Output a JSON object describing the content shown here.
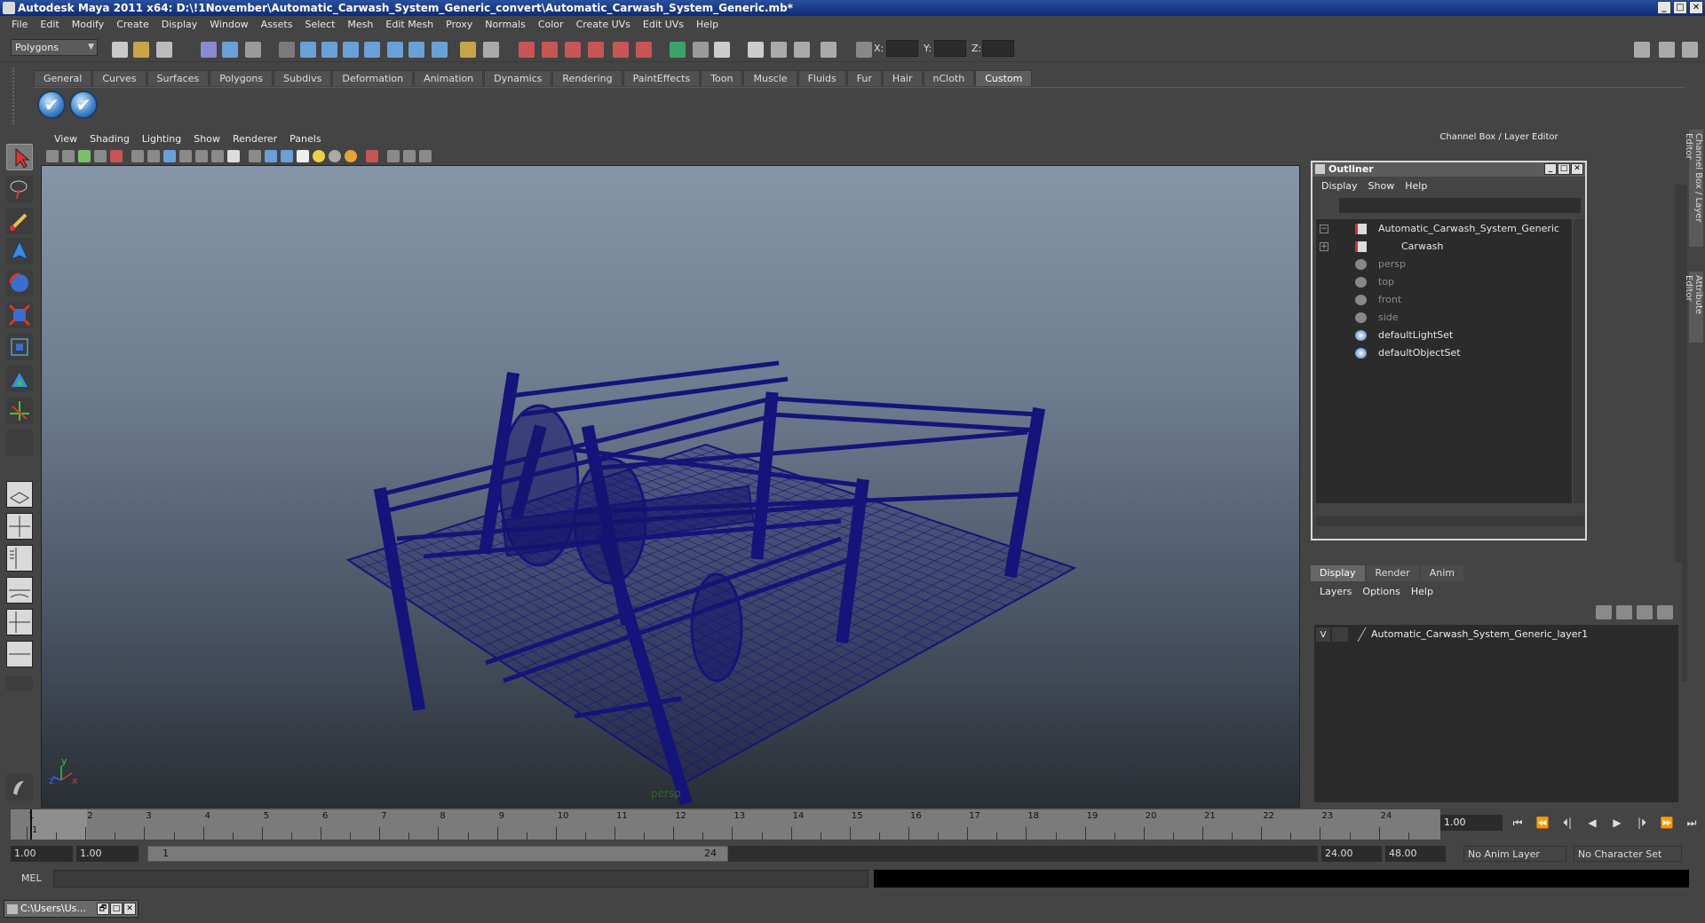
{
  "window": {
    "title": "Autodesk Maya 2011 x64: D:\\!1November\\Automatic_Carwash_System_Generic_convert\\Automatic_Carwash_System_Generic.mb*",
    "buttons": [
      "_",
      "□",
      "✕"
    ]
  },
  "menubar": [
    "File",
    "Edit",
    "Modify",
    "Create",
    "Display",
    "Window",
    "Assets",
    "Select",
    "Mesh",
    "Edit Mesh",
    "Proxy",
    "Normals",
    "Color",
    "Create UVs",
    "Edit UVs",
    "Help"
  ],
  "statusline": {
    "mode": "Polygons",
    "coord_labels": [
      "X:",
      "Y:",
      "Z:"
    ]
  },
  "shelf": {
    "tabs": [
      "General",
      "Curves",
      "Surfaces",
      "Polygons",
      "Subdivs",
      "Deformation",
      "Animation",
      "Dynamics",
      "Rendering",
      "PaintEffects",
      "Toon",
      "Muscle",
      "Fluids",
      "Fur",
      "Hair",
      "nCloth",
      "Custom"
    ],
    "active_tab": "Custom"
  },
  "viewport": {
    "menu": [
      "View",
      "Shading",
      "Lighting",
      "Show",
      "Renderer",
      "Panels"
    ],
    "camera": "persp",
    "axis_labels": [
      "y",
      "x",
      "z"
    ],
    "wire_color": "#14147a"
  },
  "channel_box": {
    "title": "Channel Box / Layer Editor",
    "side_tabs": [
      "Channel Box / Layer Editor",
      "Attribute Editor"
    ]
  },
  "outliner": {
    "title": "Outliner",
    "menu": [
      "Display",
      "Show",
      "Help"
    ],
    "items": [
      {
        "label": "Automatic_Carwash_System_Generic",
        "expander": "−",
        "icon": "transform-icon",
        "dim": false
      },
      {
        "label": "Carwash",
        "expander": "+",
        "icon": "transform-icon",
        "dim": false
      },
      {
        "label": "persp",
        "expander": "",
        "icon": "camera-icon",
        "dim": true
      },
      {
        "label": "top",
        "expander": "",
        "icon": "camera-icon",
        "dim": true
      },
      {
        "label": "front",
        "expander": "",
        "icon": "camera-icon",
        "dim": true
      },
      {
        "label": "side",
        "expander": "",
        "icon": "camera-icon",
        "dim": true
      },
      {
        "label": "defaultLightSet",
        "expander": "",
        "icon": "set-icon",
        "dim": false
      },
      {
        "label": "defaultObjectSet",
        "expander": "",
        "icon": "set-icon",
        "dim": false
      }
    ]
  },
  "layer_editor": {
    "tabs": [
      "Display",
      "Render",
      "Anim"
    ],
    "active_tab": "Display",
    "menu": [
      "Layers",
      "Options",
      "Help"
    ],
    "layers": [
      {
        "visible": "V",
        "name": "Automatic_Carwash_System_Generic_layer1"
      }
    ]
  },
  "timeline": {
    "ticks": [
      "1",
      "2",
      "3",
      "4",
      "5",
      "6",
      "7",
      "8",
      "9",
      "10",
      "11",
      "12",
      "13",
      "14",
      "15",
      "16",
      "17",
      "18",
      "19",
      "20",
      "21",
      "22",
      "23",
      "24"
    ],
    "current_marker": "1",
    "current_frame": "1.00",
    "play_controls": [
      "⏮",
      "⏪",
      "⏴|",
      "◀",
      "▶",
      "|⏵",
      "⏩",
      "⏭"
    ]
  },
  "range": {
    "anim_start": "1.00",
    "range_start": "1.00",
    "handle_start": "1",
    "handle_end": "24",
    "range_end": "24.00",
    "anim_end": "48.00",
    "anim_layer": "No Anim Layer",
    "character_set": "No Character Set"
  },
  "command_line": {
    "label": "MEL"
  },
  "taskbar": {
    "item": "C:\\Users\\Us...",
    "buttons": [
      "🗗",
      "□",
      "✕"
    ]
  }
}
